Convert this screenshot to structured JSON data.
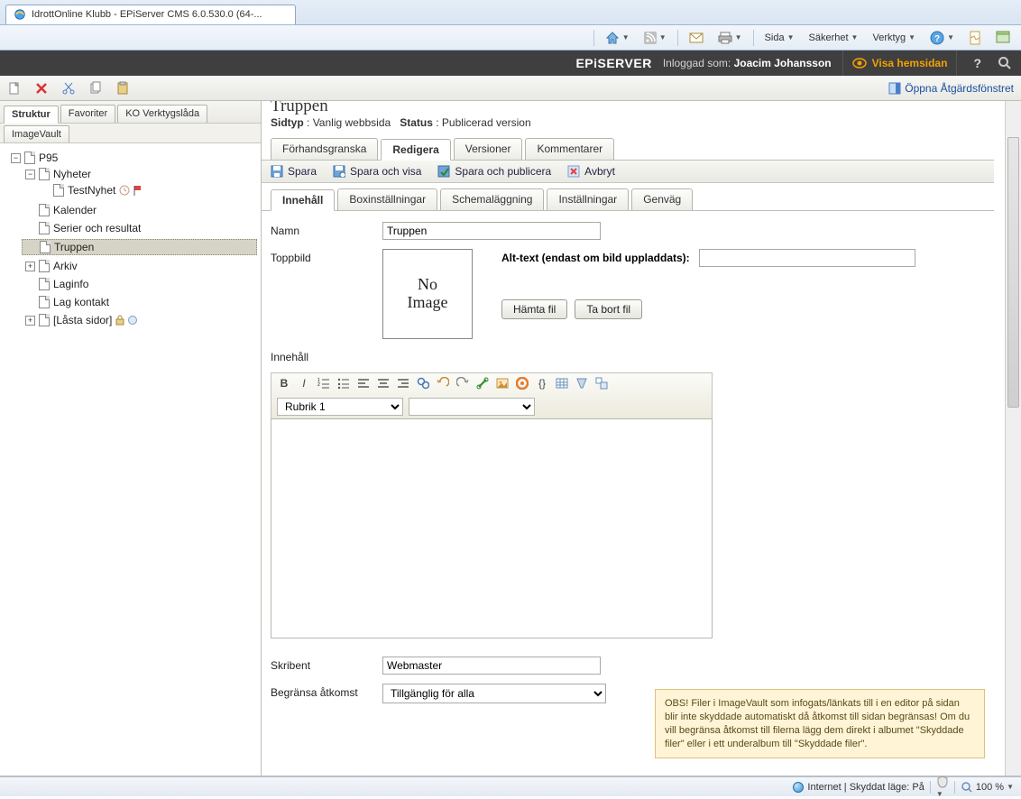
{
  "ie": {
    "tab_title": "IdrottOnline Klubb - EPiServer CMS 6.0.530.0 (64-...",
    "menu": {
      "sida": "Sida",
      "sakerhet": "Säkerhet",
      "verktyg": "Verktyg"
    },
    "status": {
      "zone": "Internet | Skyddat läge: På",
      "zoom": "100 %"
    }
  },
  "epi": {
    "logo": "EPiSERVER",
    "user_prefix": "Inloggad som:",
    "user_name": "Joacim Johansson",
    "view_site": "Visa hemsidan",
    "help": "?",
    "open_panel": "Öppna Åtgärdsfönstret"
  },
  "sidebar": {
    "tabs": {
      "struktur": "Struktur",
      "favoriter": "Favoriter",
      "ko": "KO Verktygslåda",
      "imagevault": "ImageVault"
    },
    "tree": {
      "root": "P95",
      "nyheter": "Nyheter",
      "testnyhet": "TestNyhet",
      "kalender": "Kalender",
      "serier": "Serier och resultat",
      "truppen": "Truppen",
      "arkiv": "Arkiv",
      "laginfo": "Laginfo",
      "lagkontakt": "Lag kontakt",
      "lasta": "[Låsta sidor]"
    }
  },
  "page": {
    "title": "Truppen",
    "sidtyp_label": "Sidtyp",
    "sidtyp_value": "Vanlig webbsida",
    "status_label": "Status",
    "status_value": "Publicerad version",
    "section_tabs": {
      "preview": "Förhandsgranska",
      "edit": "Redigera",
      "versions": "Versioner",
      "comments": "Kommentarer"
    },
    "actions": {
      "save": "Spara",
      "save_view": "Spara och visa",
      "save_publish": "Spara och publicera",
      "cancel": "Avbryt"
    },
    "sub_tabs": {
      "content": "Innehåll",
      "box": "Boxinställningar",
      "schedule": "Schemaläggning",
      "settings": "Inställningar",
      "shortcut": "Genväg"
    },
    "form": {
      "name_label": "Namn",
      "name_value": "Truppen",
      "topimg_label": "Toppbild",
      "noimg1": "No",
      "noimg2": "Image",
      "alt_label": "Alt-text (endast om bild uppladdats):",
      "fetch_file": "Hämta fil",
      "remove_file": "Ta bort fil",
      "content_label": "Innehåll",
      "style_value": "Rubrik 1",
      "writer_label": "Skribent",
      "writer_value": "Webmaster",
      "access_label": "Begränsa åtkomst",
      "access_value": "Tillgänglig för alla",
      "warning": "OBS! Filer i ImageVault som infogats/länkats till i en editor på sidan blir inte skyddade automatiskt då åtkomst till sidan begränsas! Om du vill begränsa åtkomst till filerna lägg dem direkt i albumet \"Skyddade filer\" eller i ett underalbum till \"Skyddade filer\"."
    }
  }
}
